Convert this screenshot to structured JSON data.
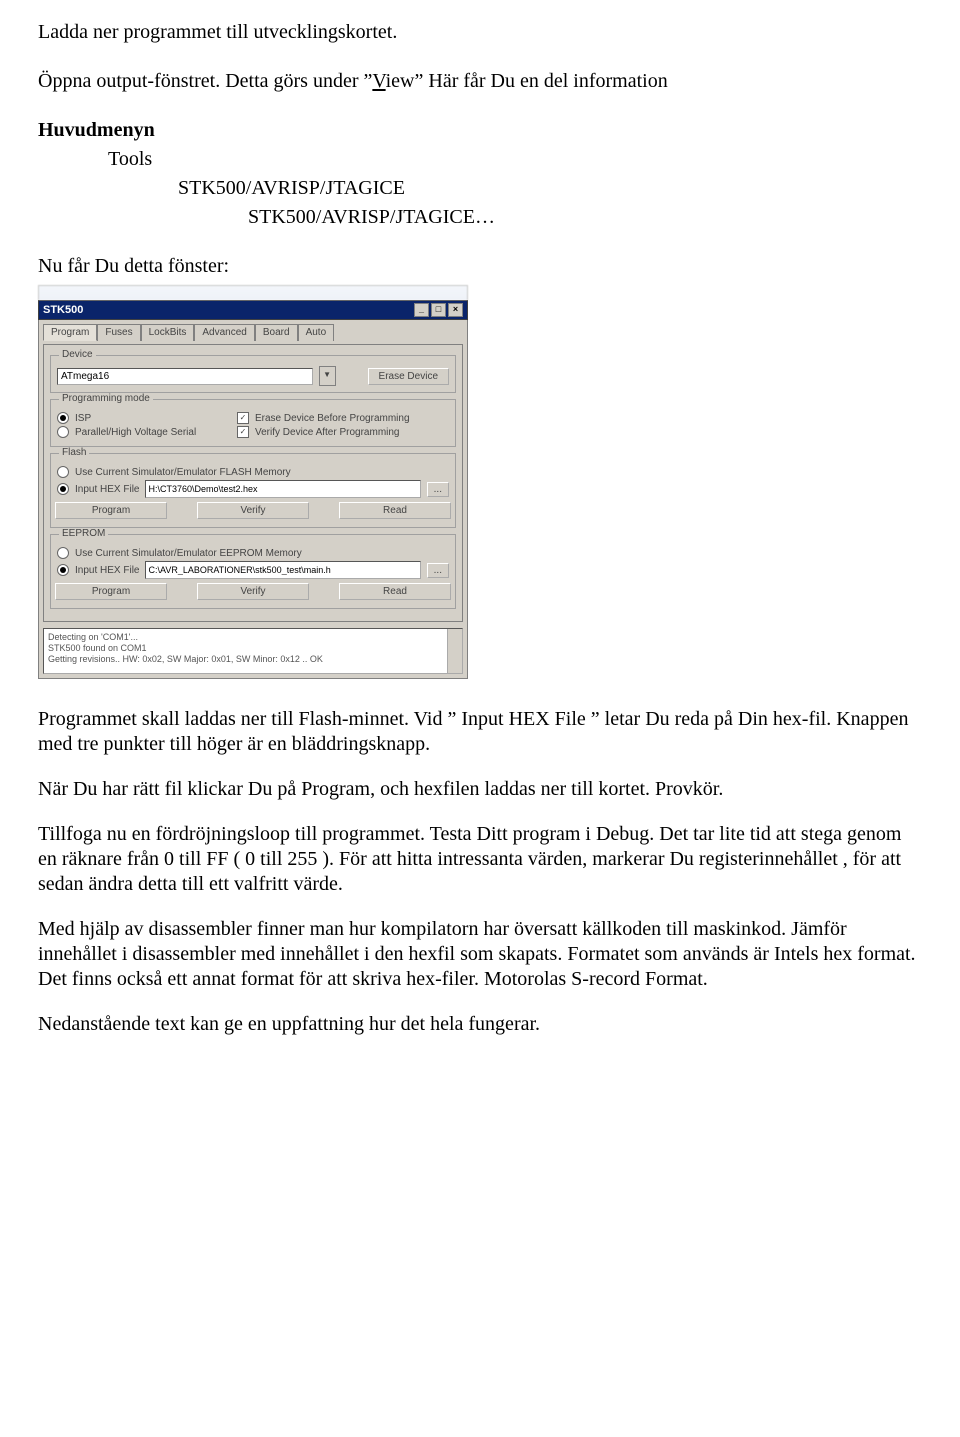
{
  "doc": {
    "p1": "Ladda ner programmet till utvecklingskortet.",
    "p2a": "Öppna output-fönstret. Detta görs under ”",
    "p2_view_letter": "V",
    "p2_view_rest": "iew",
    "p2b": "” Här får Du en del information",
    "menu_heading": "Huvudmenyn",
    "menu_l1": "Tools",
    "menu_l2": "STK500/AVRISP/JTAGICE",
    "menu_l3": "STK500/AVRISP/JTAGICE…",
    "p3": "Nu får Du detta fönster:",
    "p4": "Programmet skall laddas ner till Flash-minnet. Vid ” Input HEX File ” letar Du reda på Din hex-fil. Knappen med tre punkter till höger är en bläddringsknapp.",
    "p5": "När Du har rätt fil klickar Du på Program, och hexfilen laddas ner till kortet. Provkör.",
    "p6": "Tillfoga nu en fördröjningsloop till programmet. Testa Ditt program i Debug. Det tar lite tid att stega genom en räknare från 0 till FF ( 0 till 255 ). För att hitta intressanta värden, markerar Du registerinnehållet , för att sedan ändra detta till ett valfritt värde.",
    "p7": "Med hjälp av disassembler finner man hur kompilatorn har översatt källkoden till maskinkod.  Jämför innehållet i disassembler med innehållet i den hexfil som skapats. Formatet som används är Intels hex format.  Det finns också ett annat format för att skriva hex-filer. Motorolas  S-record Format.",
    "p8": "Nedanstående text kan ge en uppfattning hur det hela fungerar."
  },
  "window": {
    "title": "STK500",
    "tabs": [
      "Program",
      "Fuses",
      "LockBits",
      "Advanced",
      "Board",
      "Auto"
    ],
    "device": {
      "legend": "Device",
      "value": "ATmega16",
      "erase_btn": "Erase Device"
    },
    "progmode": {
      "legend": "Programming mode",
      "isp": "ISP",
      "parallel": "Parallel/High Voltage Serial",
      "erase_before": "Erase Device Before Programming",
      "verify_after": "Verify Device After Programming"
    },
    "flash": {
      "legend": "Flash",
      "use_current": "Use Current Simulator/Emulator FLASH Memory",
      "input_label": "Input HEX File",
      "input_value": "H:\\CT3760\\Demo\\test2.hex",
      "browse": "...",
      "btn_program": "Program",
      "btn_verify": "Verify",
      "btn_read": "Read"
    },
    "eeprom": {
      "legend": "EEPROM",
      "use_current": "Use Current Simulator/Emulator EEPROM Memory",
      "input_label": "Input HEX File",
      "input_value": "C:\\AVR_LABORATIONER\\stk500_test\\main.h",
      "browse": "...",
      "btn_program": "Program",
      "btn_verify": "Verify",
      "btn_read": "Read"
    },
    "log": {
      "l1": "Detecting on 'COM1'...",
      "l2": "STK500 found on COM1",
      "l3": "Getting revisions.. HW: 0x02, SW Major: 0x01, SW Minor: 0x12 .. OK"
    }
  }
}
